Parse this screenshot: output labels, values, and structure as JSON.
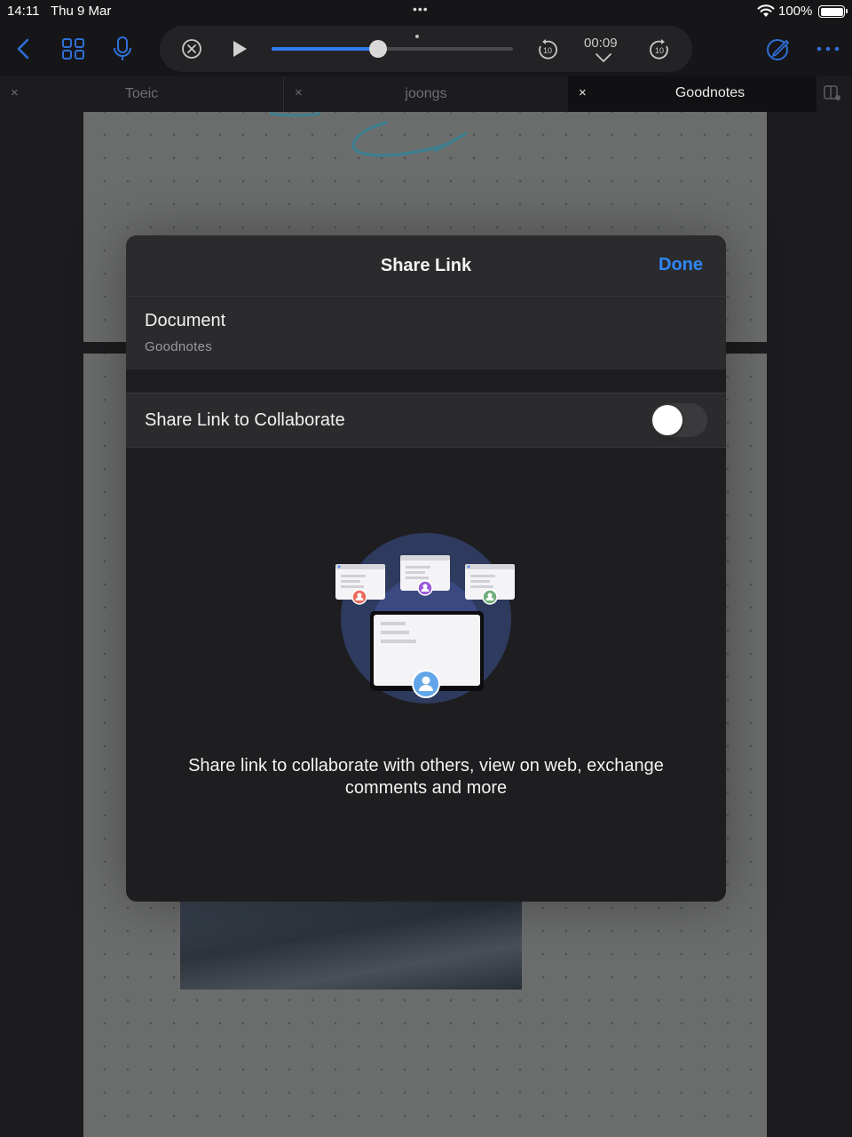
{
  "status_bar": {
    "time": "14:11",
    "date": "Thu 9 Mar",
    "multitask_dots": "•••",
    "battery_percent": "100%"
  },
  "toolbar": {
    "back_icon": "chevron-left-icon",
    "grid_icon": "grid-icon",
    "mic_icon": "microphone-icon",
    "more_icon": "ellipsis-icon",
    "edit_icon": "pen-circle-icon"
  },
  "player": {
    "elapsed": "00:09",
    "progress": 0.44,
    "skip_back_label": "10",
    "skip_forward_label": "10"
  },
  "tabs": [
    {
      "label": "Toeic",
      "active": false
    },
    {
      "label": "joongs",
      "active": false
    },
    {
      "label": "Goodnotes",
      "active": true
    }
  ],
  "modal": {
    "title": "Share Link",
    "done_label": "Done",
    "document_label": "Document",
    "document_name": "Goodnotes",
    "collaborate_label": "Share Link to Collaborate",
    "collaborate_enabled": false,
    "description": "Share link to collaborate with others, view on web, exchange comments and more"
  },
  "colors": {
    "accent": "#2f86f6",
    "modal_bg": "#1e1e20",
    "row_bg": "#2b2b2d"
  }
}
